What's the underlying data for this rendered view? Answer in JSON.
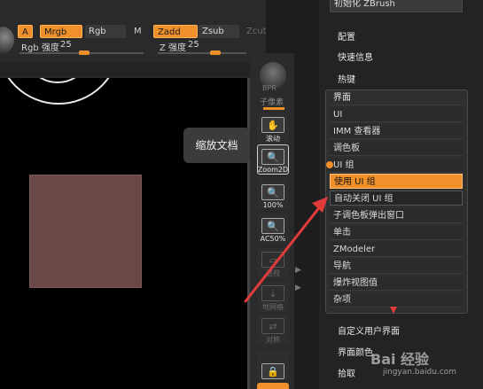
{
  "toolbar": {
    "chips": {
      "a": "A",
      "mrgb": "Mrgb",
      "rgb": "Rgb",
      "m": "M",
      "zadd": "Zadd",
      "zsub": "Zsub",
      "zcut": "Zcut"
    },
    "rgb_intensity": {
      "label": "Rgb 强度",
      "value": "25"
    },
    "z_intensity": {
      "label": "Z 强度",
      "value": "25"
    }
  },
  "tools": {
    "bpr": "BPR",
    "subpixel": "子像素",
    "scroll": "滚动",
    "zoom2d": "Zoom2D",
    "zoom100": "100%",
    "ac50": "AC50%",
    "perspective": "透视",
    "floor": "地网格",
    "symmetry": "对称"
  },
  "tooltip": "缩放文档",
  "menu": {
    "init_zbrush": "初始化 ZBrush",
    "config": "配置",
    "quick_info": "快速信息",
    "hotkeys": "热键",
    "custom_ui": "自定义用户界面",
    "ui_colors": "界面颜色",
    "pick": "拾取"
  },
  "submenu": {
    "header": "界面",
    "items": [
      "UI",
      "IMM 查看器",
      "调色板",
      "UI 组",
      "使用 UI 组",
      "自动关闭 UI 组",
      "子调色板弹出窗口",
      "单击",
      "ZModeler",
      "导航",
      "爆炸视图值",
      "杂项"
    ]
  },
  "watermark": {
    "text": "Bai 经验",
    "url": "jingyan.baidu.com"
  },
  "colors": {
    "accent": "#f0902a",
    "arrow": "#e23b3b",
    "canvas": "#000000",
    "shape": "#6b4848"
  }
}
